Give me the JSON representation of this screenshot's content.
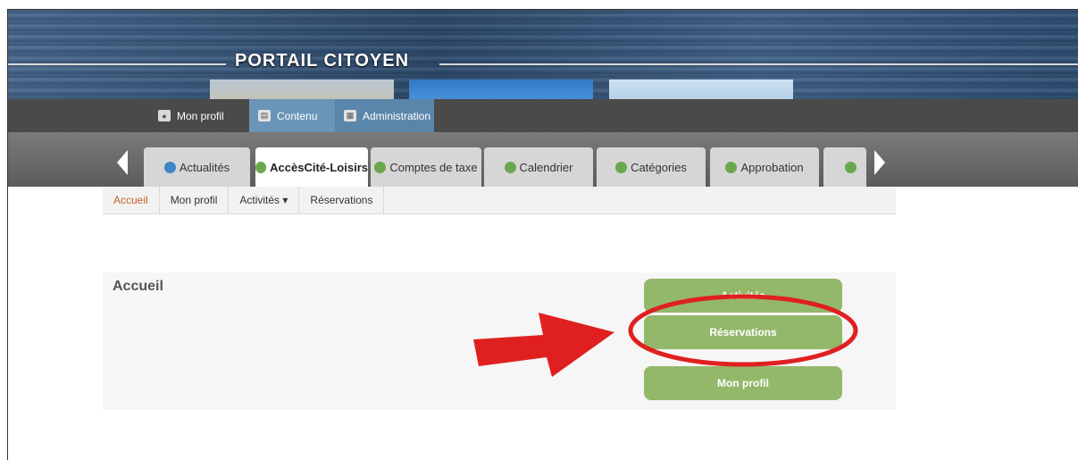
{
  "banner": {
    "title": "PORTAIL CITOYEN"
  },
  "toolbar": {
    "items": [
      {
        "label": "Mon profil",
        "icon": "person-icon"
      },
      {
        "label": "Contenu",
        "icon": "document-icon"
      },
      {
        "label": "Administration",
        "icon": "admin-icon"
      }
    ]
  },
  "tabs": {
    "items": [
      {
        "label": "Actualités",
        "icon": "home-icon"
      },
      {
        "label": "AccèsCité-Loisirs",
        "icon": "leaf-icon"
      },
      {
        "label": "Comptes de taxe",
        "icon": "leaf-icon"
      },
      {
        "label": "Calendrier",
        "icon": "leaf-icon"
      },
      {
        "label": "Catégories",
        "icon": "leaf-icon"
      },
      {
        "label": "Approbation",
        "icon": "leaf-icon"
      }
    ]
  },
  "subnav": {
    "items": [
      {
        "label": "Accueil"
      },
      {
        "label": "Mon profil"
      },
      {
        "label": "Activités ▾"
      },
      {
        "label": "Réservations"
      }
    ]
  },
  "main": {
    "title": "Accueil",
    "buttons": [
      {
        "label": "Activités"
      },
      {
        "label": "Réservations"
      },
      {
        "label": "Mon profil"
      }
    ]
  },
  "colors": {
    "accent_green": "#93b86a",
    "toolbar_blue": "#6a95b8",
    "annotation_red": "#e02020",
    "active_link": "#c75f2a"
  }
}
